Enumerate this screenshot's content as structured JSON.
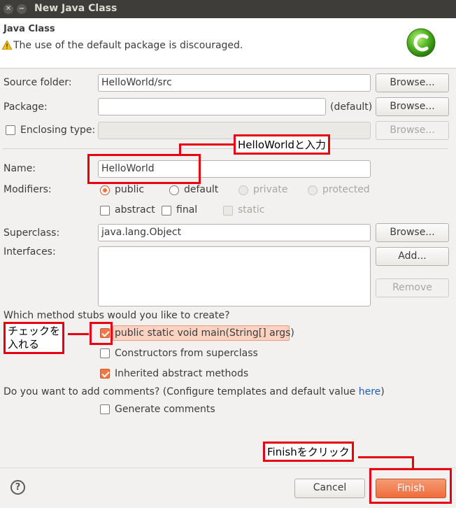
{
  "window": {
    "title": "New Java Class"
  },
  "header": {
    "title": "Java Class",
    "message": "The use of the default package is discouraged."
  },
  "form": {
    "source_folder": {
      "label": "Source folder:",
      "value": "HelloWorld/src",
      "browse": "Browse..."
    },
    "package": {
      "label": "Package:",
      "value": "",
      "hint": "(default)",
      "browse": "Browse..."
    },
    "enclosing_type": {
      "label": "Enclosing type:",
      "value": "",
      "checked": false,
      "browse": "Browse..."
    },
    "name": {
      "label": "Name:",
      "value": "HelloWorld"
    },
    "modifiers": {
      "label": "Modifiers:",
      "access": [
        "public",
        "default",
        "private",
        "protected"
      ],
      "selected": "public",
      "other": [
        "abstract",
        "final",
        "static"
      ]
    },
    "superclass": {
      "label": "Superclass:",
      "value": "java.lang.Object",
      "browse": "Browse..."
    },
    "interfaces": {
      "label": "Interfaces:",
      "add": "Add...",
      "remove": "Remove"
    },
    "stubs": {
      "question": "Which method stubs would you like to create?",
      "main": {
        "label": "public static void main(String[] args)",
        "checked": true
      },
      "constructors": {
        "label": "Constructors from superclass",
        "checked": false
      },
      "inherited": {
        "label": "Inherited abstract methods",
        "checked": true
      }
    },
    "comments": {
      "question_prefix": "Do you want to add comments? (Configure templates and default value ",
      "link": "here",
      "question_suffix": ")",
      "generate": {
        "label": "Generate comments",
        "checked": false
      }
    }
  },
  "footer": {
    "help": "?",
    "cancel": "Cancel",
    "finish": "Finish"
  },
  "annotations": {
    "name_hint": "HelloWorldと入力",
    "check_hint_line1": "チェックを",
    "check_hint_line2": "入れる",
    "finish_hint": "Finishをクリック"
  },
  "colors": {
    "accent": "#f07746",
    "annotation_red": "#e60012",
    "titlebar": "#3e3d39"
  }
}
